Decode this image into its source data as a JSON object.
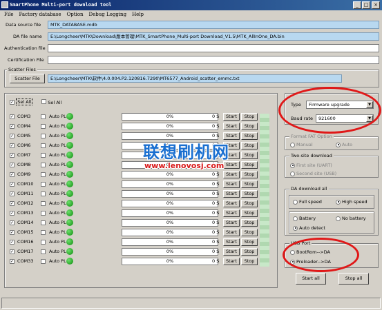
{
  "window": {
    "title": "SmartPhone Multi-port download tool",
    "min": "_",
    "max": "□",
    "close": "×"
  },
  "menu": [
    "File",
    "Factory database",
    "Option",
    "Debug Logging",
    "Help"
  ],
  "fields": {
    "data_source": {
      "label": "Data source file",
      "value": "MTK_DATABASE.mdb"
    },
    "da_file": {
      "label": "DA file name",
      "value": "E:\\Longcheer\\MTK\\Download\\版本管理\\MTK_SmartPhone_Multi-port Download_V1.5\\MTK_AllInOne_DA.bin"
    },
    "auth": {
      "label": "Authentication file",
      "value": ""
    },
    "cert": {
      "label": "Certification File",
      "value": ""
    }
  },
  "scatter": {
    "group": "Scatter Files",
    "button": "Scatter File",
    "value": "E:\\Longcheer\\MTK\\软件\\4.0.004.P2.120816.7290\\MT6577_Android_scatter_emmc.txt"
  },
  "sel_all_1": "Sel All",
  "sel_all_2": "Sel All",
  "rows": [
    {
      "port": "COM3",
      "auto": "Auto PL",
      "progress": "0%",
      "secs": "0 S",
      "start": "Start",
      "stop": "Stop"
    },
    {
      "port": "COM4",
      "auto": "Auto PL",
      "progress": "0%",
      "secs": "0 S",
      "start": "Start",
      "stop": "Stop"
    },
    {
      "port": "COM5",
      "auto": "Auto PL",
      "progress": "0%",
      "secs": "0 S",
      "start": "Start",
      "stop": "Stop"
    },
    {
      "port": "COM6",
      "auto": "Auto PL",
      "progress": "0%",
      "secs": "0 S",
      "start": "Start",
      "stop": "Stop"
    },
    {
      "port": "COM7",
      "auto": "Auto PL",
      "progress": "0%",
      "secs": "0 S",
      "start": "Start",
      "stop": "Stop"
    },
    {
      "port": "COM8",
      "auto": "Auto PL",
      "progress": "0%",
      "secs": "0 S",
      "start": "Start",
      "stop": "Stop"
    },
    {
      "port": "COM9",
      "auto": "Auto PL",
      "progress": "0%",
      "secs": "0 S",
      "start": "Start",
      "stop": "Stop"
    },
    {
      "port": "COM10",
      "auto": "Auto PL",
      "progress": "0%",
      "secs": "0 S",
      "start": "Start",
      "stop": "Stop"
    },
    {
      "port": "COM11",
      "auto": "Auto PL",
      "progress": "0%",
      "secs": "0 S",
      "start": "Start",
      "stop": "Stop"
    },
    {
      "port": "COM12",
      "auto": "Auto PL",
      "progress": "0%",
      "secs": "0 S",
      "start": "Start",
      "stop": "Stop"
    },
    {
      "port": "COM13",
      "auto": "Auto PL",
      "progress": "0%",
      "secs": "0 S",
      "start": "Start",
      "stop": "Stop"
    },
    {
      "port": "COM14",
      "auto": "Auto PL",
      "progress": "0%",
      "secs": "0 S",
      "start": "Start",
      "stop": "Stop"
    },
    {
      "port": "COM15",
      "auto": "Auto PL",
      "progress": "0%",
      "secs": "0 S",
      "start": "Start",
      "stop": "Stop"
    },
    {
      "port": "COM16",
      "auto": "Auto PL",
      "progress": "0%",
      "secs": "0 S",
      "start": "Start",
      "stop": "Stop"
    },
    {
      "port": "COM17",
      "auto": "Auto PL",
      "progress": "0%",
      "secs": "0 S",
      "start": "Start",
      "stop": "Stop"
    },
    {
      "port": "COM33",
      "auto": "Auto PL",
      "progress": "0%",
      "secs": "0 S",
      "start": "Start",
      "stop": "Stop"
    }
  ],
  "right": {
    "type_label": "Type",
    "type_value": "Firmware upgrade",
    "baud_label": "Baud rate",
    "baud_value": "921600",
    "fat": {
      "title": "Format FAT Option",
      "manual": "Manual",
      "auto": "Auto"
    },
    "twosite": {
      "title": "Two-site download",
      "first": "First site (UART)",
      "second": "Second site (USB)"
    },
    "da": {
      "title": "DA download all",
      "full": "Full speed",
      "high": "High speed",
      "battery": "Battery",
      "nobattery": "No battery",
      "autodetect": "Auto detect"
    },
    "usb": {
      "title": "USB Port",
      "bootrom": "BootRom-->DA",
      "preloader": "Preloader-->DA"
    },
    "start_all": "Start all",
    "stop_all": "Stop all"
  },
  "watermark": {
    "cn": "联想刷机网",
    "url": "www.lenovosj.com"
  },
  "arrow": "▼",
  "check": "✓"
}
